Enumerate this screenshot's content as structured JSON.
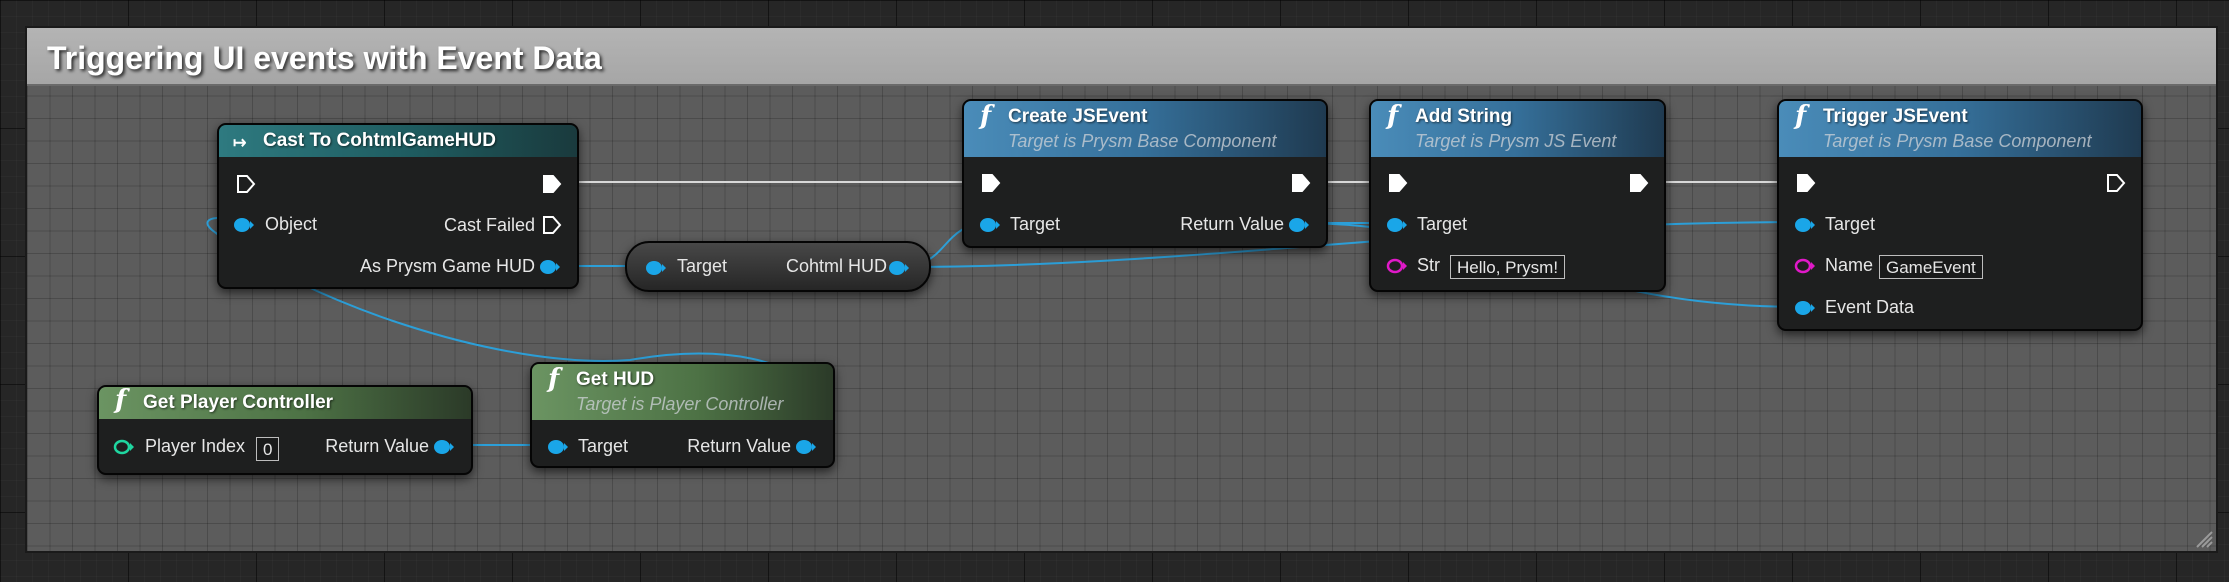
{
  "comment": {
    "title": "Triggering UI events with Event Data"
  },
  "nodes": {
    "cast": {
      "title": "Cast To CohtmlGameHUD",
      "pins": {
        "object": "Object",
        "cast_failed": "Cast Failed",
        "as_hud": "As Prysm Game HUD"
      }
    },
    "reroute": {
      "target": "Target",
      "output": "Cohtml HUD"
    },
    "create_event": {
      "title": "Create JSEvent",
      "subtitle": "Target is Prysm Base Component",
      "pins": {
        "target": "Target",
        "return_value": "Return Value"
      }
    },
    "add_string": {
      "title": "Add String",
      "subtitle": "Target is Prysm JS Event",
      "pins": {
        "target": "Target",
        "str": "Str"
      },
      "str_value": "Hello, Prysm!"
    },
    "trigger_event": {
      "title": "Trigger JSEvent",
      "subtitle": "Target is Prysm Base Component",
      "pins": {
        "target": "Target",
        "name": "Name",
        "event_data": "Event Data"
      },
      "name_value": "GameEvent"
    },
    "get_player_controller": {
      "title": "Get Player Controller",
      "pins": {
        "player_index": "Player Index",
        "return_value": "Return Value"
      },
      "player_index_value": "0"
    },
    "get_hud": {
      "title": "Get HUD",
      "subtitle": "Target is Player Controller",
      "pins": {
        "target": "Target",
        "return_value": "Return Value"
      }
    }
  },
  "colors": {
    "exec": "#ffffff",
    "object_pin": "#1aa6e8",
    "string_pin": "#e019c8",
    "int_pin": "#1fd6a0",
    "wire_blue": "#2c9fd8"
  }
}
